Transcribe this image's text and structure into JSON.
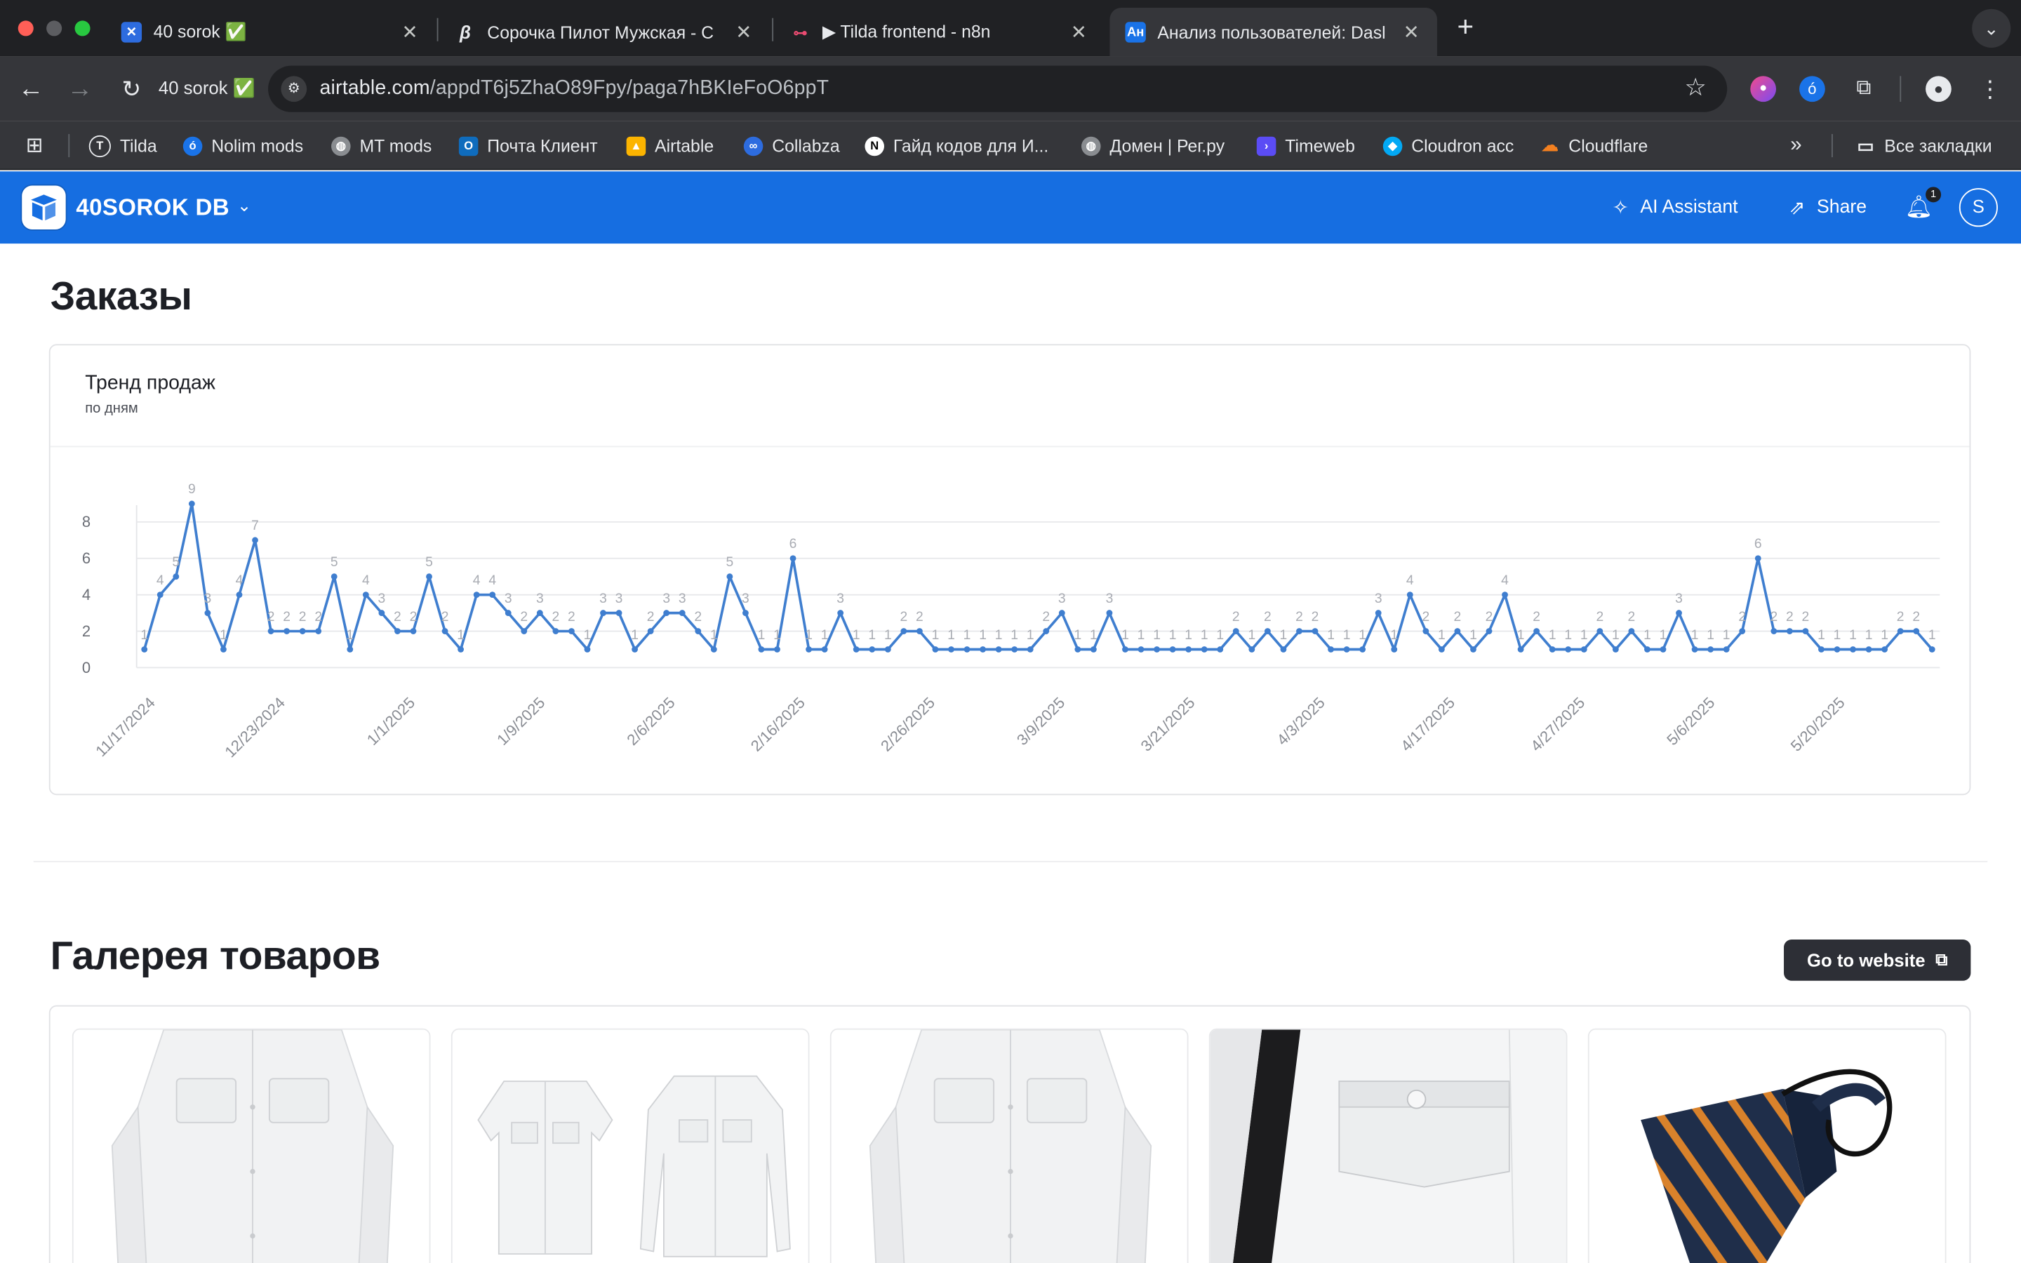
{
  "browser": {
    "tabs": [
      {
        "title": "40 sorok ✅",
        "favicon": "airtable-icon",
        "active": false
      },
      {
        "title": "Сорочка Пилот Мужская - С",
        "favicon": "tilda-b-icon",
        "active": false
      },
      {
        "title": "▶ Tilda frontend - n8n",
        "favicon": "n8n-icon",
        "active": false
      },
      {
        "title": "Анализ пользователей: Dasl",
        "favicon": "an-icon",
        "active": true
      }
    ],
    "workspace_label": "40 sorok ✅",
    "url_host": "airtable.com",
    "url_path": "/appdT6j5ZhaO89Fpy/paga7hBKIeFoO6ppT",
    "bookmarks": [
      {
        "label": "Tilda",
        "icon": "tilda-icon"
      },
      {
        "label": "Nolim mods",
        "icon": "nolim-icon"
      },
      {
        "label": "MT mods",
        "icon": "globe-icon"
      },
      {
        "label": "Почта Клиент",
        "icon": "outlook-icon"
      },
      {
        "label": "Airtable",
        "icon": "airtable-icon"
      },
      {
        "label": "Collabza",
        "icon": "link-icon"
      },
      {
        "label": "Гайд кодов для И...",
        "icon": "notion-icon"
      },
      {
        "label": "Домен | Рег.ру",
        "icon": "globe-icon"
      },
      {
        "label": "Timeweb",
        "icon": "timeweb-icon"
      },
      {
        "label": "Cloudron acc",
        "icon": "cloudron-icon"
      },
      {
        "label": "Cloudflare",
        "icon": "cloudflare-icon"
      }
    ],
    "all_bookmarks_label": "Все закладки"
  },
  "app": {
    "name": "40SOROK DB",
    "ai_assistant_label": "AI Assistant",
    "share_label": "Share",
    "notification_count": "1",
    "avatar_initial": "S",
    "brand_color": "#166ee1"
  },
  "orders": {
    "heading": "Заказы",
    "chart_title": "Тренд продаж",
    "chart_subtitle": "по дням"
  },
  "chart_data": {
    "type": "line",
    "title": "Тренд продаж",
    "subtitle": "по дням",
    "ylim": [
      0,
      8
    ],
    "y_ticks": [
      0,
      2,
      4,
      6,
      8
    ],
    "grid": true,
    "series_color": "#3f7ecf",
    "x_tick_labels": [
      "11/17/2024",
      "12/23/2024",
      "1/1/2025",
      "1/9/2025",
      "2/6/2025",
      "2/16/2025",
      "2/26/2025",
      "3/9/2025",
      "3/21/2025",
      "4/3/2025",
      "4/17/2025",
      "4/27/2025",
      "5/6/2025",
      "5/20/2025"
    ],
    "values": [
      1,
      4,
      5,
      9,
      3,
      1,
      4,
      7,
      2,
      2,
      2,
      2,
      5,
      1,
      4,
      3,
      2,
      2,
      5,
      2,
      1,
      4,
      4,
      3,
      2,
      3,
      2,
      2,
      1,
      3,
      3,
      1,
      2,
      3,
      3,
      2,
      1,
      5,
      3,
      1,
      1,
      6,
      1,
      1,
      3,
      1,
      1,
      1,
      2,
      2,
      1,
      1,
      1,
      1,
      1,
      1,
      1,
      2,
      3,
      1,
      1,
      3,
      1,
      1,
      1,
      1,
      1,
      1,
      1,
      2,
      1,
      2,
      1,
      2,
      2,
      1,
      1,
      1,
      3,
      1,
      4,
      2,
      1,
      2,
      1,
      2,
      4,
      1,
      2,
      1,
      1,
      1,
      2,
      1,
      2,
      1,
      1,
      3,
      1,
      1,
      1,
      2,
      6,
      2,
      2,
      2,
      1,
      1,
      1,
      1,
      1,
      2,
      2,
      1
    ]
  },
  "gallery": {
    "heading": "Галерея товаров",
    "go_button_label": "Go to website",
    "items": [
      {
        "kind": "long-sleeve-shirt"
      },
      {
        "kind": "shirt-pair"
      },
      {
        "kind": "long-sleeve-shirt"
      },
      {
        "kind": "shirt-with-black-tie"
      },
      {
        "kind": "striped-tie"
      }
    ]
  }
}
